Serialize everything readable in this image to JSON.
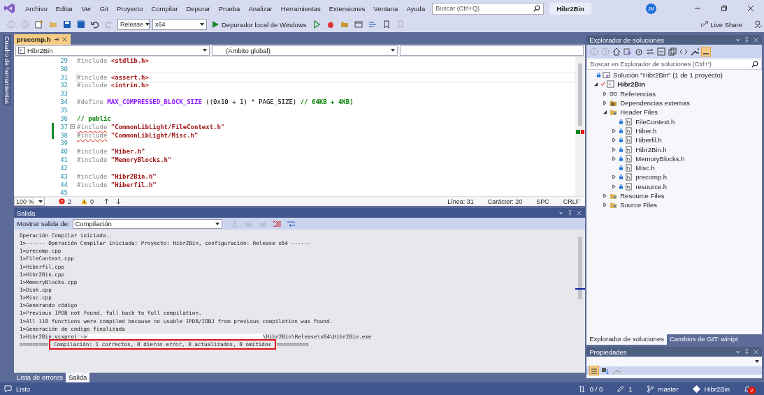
{
  "menu": [
    "Archivo",
    "Editar",
    "Ver",
    "Git",
    "Proyecto",
    "Compilar",
    "Depurar",
    "Prueba",
    "Analizar",
    "Herramientas",
    "Extensiones",
    "Ventana",
    "Ayuda"
  ],
  "search": {
    "placeholder": "Buscar (Ctrl+Q)"
  },
  "solution_badge": "Hibr2Bin",
  "user_initials": "JM",
  "toolbar": {
    "configuration": "Release",
    "platform": "x64",
    "debugger": "Depurador local de Windows",
    "live_share": "Live Share"
  },
  "toolbox_label": "Cuadro de herramientas",
  "editor": {
    "tabs": [
      {
        "label": "precomp.h",
        "selected": true
      }
    ],
    "nav": [
      "Hibr2Bin",
      "(Ámbito global)"
    ],
    "lines": [
      {
        "number": "29",
        "tokens": [
          {
            "kind": "pre",
            "text": "#include "
          },
          {
            "kind": "str",
            "text": "<stdlib.h>"
          }
        ],
        "current": false,
        "changed": false,
        "squiggle": false
      },
      {
        "number": "30",
        "current": false,
        "changed": false
      },
      {
        "number": "31",
        "tokens": [
          {
            "kind": "pre",
            "text": "#include "
          },
          {
            "kind": "str",
            "text": "<assert.h>"
          }
        ],
        "current": true,
        "changed": false,
        "squiggle": false
      },
      {
        "number": "32",
        "tokens": [
          {
            "kind": "pre",
            "text": "#include "
          },
          {
            "kind": "str",
            "text": "<intrin.h>"
          }
        ],
        "current": false,
        "changed": false,
        "squiggle": false
      },
      {
        "number": "33",
        "current": false,
        "changed": false
      },
      {
        "number": "34",
        "tokens": [
          {
            "kind": "pre",
            "text": "#define "
          },
          {
            "kind": "macro",
            "text": "MAX_COMPRESSED_BLOCK_SIZE"
          },
          {
            "kind": "plain",
            "text": " ((0x10 + 1) * PAGE_SIZE) "
          },
          {
            "kind": "comment",
            "text": "// 64KB + 4KB)"
          }
        ],
        "current": false,
        "changed": false,
        "squiggle": false
      },
      {
        "number": "35",
        "current": false,
        "changed": false
      },
      {
        "number": "36",
        "tokens": [
          {
            "kind": "comment",
            "text": "// public"
          }
        ],
        "current": false,
        "changed": false,
        "squiggle": false
      },
      {
        "number": "37",
        "tokens": [
          {
            "kind": "pre",
            "text": "#include"
          },
          {
            "kind": "str",
            "text": " \"CommonLibLight/FileContext.h\""
          }
        ],
        "current": false,
        "changed": true,
        "squiggle": true,
        "fold": true
      },
      {
        "number": "38",
        "tokens": [
          {
            "kind": "pre",
            "text": "#include"
          },
          {
            "kind": "str",
            "text": " \"CommonLibLight/Misc.h\""
          }
        ],
        "current": false,
        "changed": true,
        "squiggle": true
      },
      {
        "number": "39",
        "current": false,
        "changed": false
      },
      {
        "number": "40",
        "tokens": [
          {
            "kind": "pre",
            "text": "#include "
          },
          {
            "kind": "str",
            "text": "\"Hiber.h\""
          }
        ],
        "current": false,
        "changed": false,
        "squiggle": false
      },
      {
        "number": "41",
        "tokens": [
          {
            "kind": "pre",
            "text": "#include "
          },
          {
            "kind": "str",
            "text": "\"MemoryBlocks.h\""
          }
        ],
        "current": false,
        "changed": false,
        "squiggle": false
      },
      {
        "number": "42",
        "current": false,
        "changed": false
      },
      {
        "number": "43",
        "tokens": [
          {
            "kind": "pre",
            "text": "#include "
          },
          {
            "kind": "str",
            "text": "\"Hibr2Bin.h\""
          }
        ],
        "current": false,
        "changed": false,
        "squiggle": false
      },
      {
        "number": "44",
        "tokens": [
          {
            "kind": "pre",
            "text": "#include "
          },
          {
            "kind": "str",
            "text": "\"Hiberfil.h\""
          }
        ],
        "current": false,
        "changed": false,
        "squiggle": false
      },
      {
        "number": "45",
        "current": false,
        "changed": false
      }
    ],
    "zoom": "100 %",
    "errors": "2",
    "warnings": "0",
    "position": [
      "Línea: 31",
      "Carácter: 20",
      "SPC",
      "CRLF"
    ]
  },
  "output": {
    "title": "Salida",
    "show_label": "Mostrar salida de:",
    "source": "Compilación",
    "lines": [
      {
        "kind": "text",
        "text": "Operación Compilar iniciada.."
      },
      {
        "kind": "text",
        "text": "1>------ Operación Compilar iniciada: Proyecto: Hibr2Bin, configuración: Release x64 ------"
      },
      {
        "kind": "text",
        "text": "1>precomp.cpp"
      },
      {
        "kind": "text",
        "text": "1>FileContext.cpp"
      },
      {
        "kind": "text",
        "text": "1>Hiberfil.cpp"
      },
      {
        "kind": "text",
        "text": "1>Hibr2Bin.cpp"
      },
      {
        "kind": "text",
        "text": "1>MemoryBlocks.cpp"
      },
      {
        "kind": "text",
        "text": "1>Disk.cpp"
      },
      {
        "kind": "text",
        "text": "1>Misc.cpp"
      },
      {
        "kind": "text",
        "text": "1>Generando código"
      },
      {
        "kind": "text",
        "text": "1>Previous IPDB not found, fall back to full compilation."
      },
      {
        "kind": "text",
        "text": "1>All 110 functions were compiled because no usable IPDB/IOBJ from previous compilation was found."
      },
      {
        "kind": "text",
        "text": "1>Generación de código finalizada"
      },
      {
        "kind": "redacted",
        "before": "1>Hibr2Bin.vcxproj ->",
        "after": "\\Hibr2Bin\\Release\\x64\\Hibr2Bin.exe"
      },
      {
        "kind": "summary",
        "lead": "=========",
        "text": "Compilación: 1 correctos, 0 dieron error, 0 actualizados, 0 omitidos",
        "trail": "=========="
      }
    ],
    "tabs": [
      {
        "label": "Lista de errores",
        "selected": false
      },
      {
        "label": "Salida",
        "selected": true
      }
    ]
  },
  "solution_explorer": {
    "title": "Explorador de soluciones",
    "search": {
      "placeholder": "Buscar en Explorador de soluciones (Ctrl+')"
    },
    "tree": [
      {
        "kind": "solution",
        "label": "Solución \"Hibr2Bin\"  (1 de 1 proyecto)",
        "children": [
          {
            "kind": "project",
            "label": "Hibr2Bin",
            "expanded": true,
            "children": [
              {
                "kind": "references",
                "label": "Referencias",
                "expanded": false
              },
              {
                "kind": "deps",
                "label": "Dependencias externas",
                "expanded": false
              },
              {
                "kind": "folder",
                "label": "Header Files",
                "expanded": true,
                "children": [
                  {
                    "kind": "file",
                    "label": "FileContext.h"
                  },
                  {
                    "kind": "file",
                    "label": "Hiber.h",
                    "expanded": false
                  },
                  {
                    "kind": "file",
                    "label": "Hiberfil.h",
                    "expanded": false
                  },
                  {
                    "kind": "file",
                    "label": "Hibr2Bin.h",
                    "expanded": false
                  },
                  {
                    "kind": "file",
                    "label": "MemoryBlocks.h",
                    "expanded": false
                  },
                  {
                    "kind": "file",
                    "label": "Misc.h"
                  },
                  {
                    "kind": "file",
                    "label": "precomp.h",
                    "expanded": false
                  },
                  {
                    "kind": "file",
                    "label": "resource.h",
                    "expanded": false
                  }
                ]
              },
              {
                "kind": "folder",
                "label": "Resource Files",
                "expanded": false
              },
              {
                "kind": "folder",
                "label": "Source Files",
                "expanded": false
              }
            ]
          }
        ]
      }
    ],
    "tabs": [
      {
        "label": "Explorador de soluciones",
        "selected": true
      },
      {
        "label": "Cambios de GIT: winipt",
        "selected": false
      }
    ]
  },
  "properties": {
    "title": "Propiedades"
  },
  "status_bar": {
    "message": "Listo",
    "sync": "0 / 0",
    "edits": "1",
    "branch": "master",
    "repo": "Hibr2Bin",
    "notifications": "2"
  }
}
